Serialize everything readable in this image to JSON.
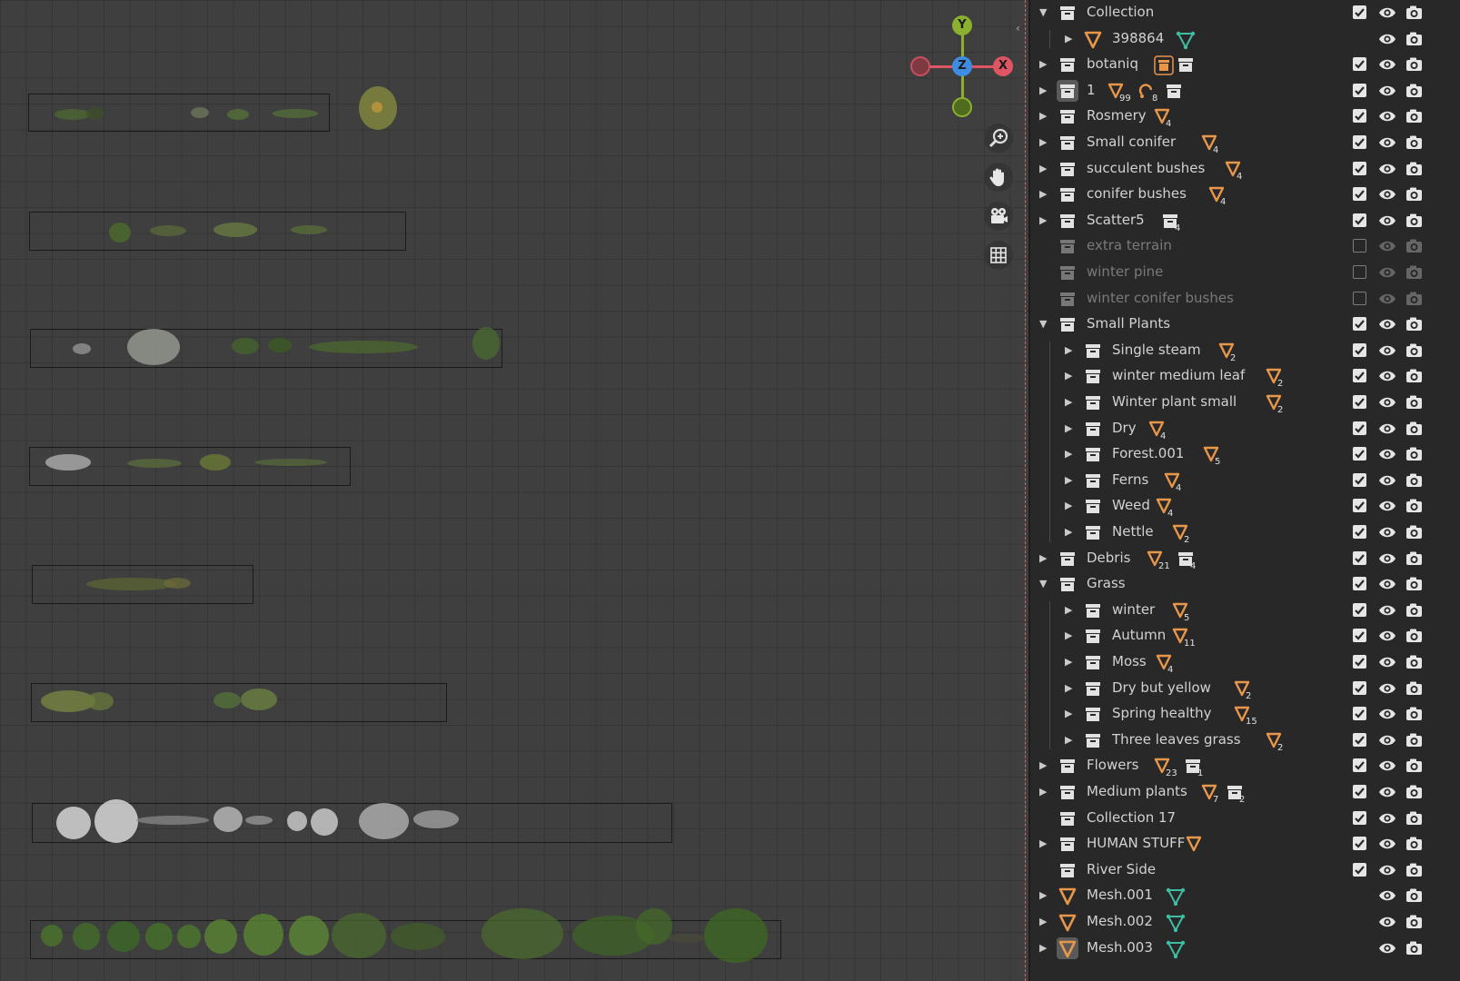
{
  "viewport": {
    "gizmo": {
      "y_label": "Y",
      "z_label": "Z",
      "x_label": "X"
    },
    "navigation": [
      {
        "name": "zoom-icon"
      },
      {
        "name": "pan-hand-icon"
      },
      {
        "name": "camera-view-icon"
      },
      {
        "name": "ortho-grid-icon"
      }
    ]
  },
  "outliner": {
    "rows": [
      {
        "label": "Collection",
        "depth": 0,
        "arrow": "down",
        "icon": "collection",
        "check": "on",
        "visible": true,
        "badges": []
      },
      {
        "label": "398864",
        "depth": 1,
        "arrow": "right",
        "icon": "mesh-object",
        "check": "none",
        "visible": true,
        "badges": [
          {
            "type": "mesh-data"
          }
        ]
      },
      {
        "label": "botaniq",
        "depth": 0,
        "arrow": "right",
        "icon": "collection",
        "check": "on",
        "visible": true,
        "badges": [
          {
            "type": "linked-collection"
          },
          {
            "type": "collection"
          }
        ]
      },
      {
        "label": "1",
        "depth": 0,
        "arrow": "right",
        "icon": "collection-selected",
        "check": "on",
        "visible": true,
        "badges": [
          {
            "type": "mesh",
            "count": "99"
          },
          {
            "type": "hook",
            "count": "8"
          },
          {
            "type": "collection"
          }
        ]
      },
      {
        "label": "Rosmery",
        "depth": 0,
        "arrow": "right",
        "icon": "collection",
        "check": "on",
        "visible": true,
        "badges": [
          {
            "type": "mesh",
            "count": "4"
          }
        ]
      },
      {
        "label": "Small conifer",
        "depth": 0,
        "arrow": "right",
        "icon": "collection",
        "check": "on",
        "visible": true,
        "badges": [
          {
            "type": "mesh",
            "count": "4"
          }
        ]
      },
      {
        "label": "succulent bushes",
        "depth": 0,
        "arrow": "right",
        "icon": "collection",
        "check": "on",
        "visible": true,
        "badges": [
          {
            "type": "mesh",
            "count": "4"
          }
        ]
      },
      {
        "label": "conifer bushes",
        "depth": 0,
        "arrow": "right",
        "icon": "collection",
        "check": "on",
        "visible": true,
        "badges": [
          {
            "type": "mesh",
            "count": "4"
          }
        ]
      },
      {
        "label": "Scatter5",
        "depth": 0,
        "arrow": "right",
        "icon": "collection",
        "check": "on",
        "visible": true,
        "badges": [
          {
            "type": "collection",
            "count": "4"
          }
        ]
      },
      {
        "label": "extra terrain",
        "depth": 0,
        "arrow": "none",
        "icon": "collection",
        "check": "off",
        "visible": false,
        "badges": []
      },
      {
        "label": "winter pine",
        "depth": 0,
        "arrow": "none",
        "icon": "collection",
        "check": "off",
        "visible": false,
        "badges": []
      },
      {
        "label": "winter conifer bushes",
        "depth": 0,
        "arrow": "none",
        "icon": "collection",
        "check": "off",
        "visible": false,
        "badges": []
      },
      {
        "label": "Small Plants",
        "depth": 0,
        "arrow": "down",
        "icon": "collection",
        "check": "on",
        "visible": true,
        "badges": []
      },
      {
        "label": "Single steam",
        "depth": 1,
        "arrow": "right",
        "icon": "collection",
        "check": "on",
        "visible": true,
        "badges": [
          {
            "type": "mesh",
            "count": "2"
          }
        ]
      },
      {
        "label": "winter medium leaf",
        "depth": 1,
        "arrow": "right",
        "icon": "collection",
        "check": "on",
        "visible": true,
        "badges": [
          {
            "type": "mesh",
            "count": "2"
          }
        ]
      },
      {
        "label": "Winter plant small",
        "depth": 1,
        "arrow": "right",
        "icon": "collection",
        "check": "on",
        "visible": true,
        "badges": [
          {
            "type": "mesh",
            "count": "2"
          }
        ]
      },
      {
        "label": "Dry",
        "depth": 1,
        "arrow": "right",
        "icon": "collection",
        "check": "on",
        "visible": true,
        "badges": [
          {
            "type": "mesh",
            "count": "4"
          }
        ]
      },
      {
        "label": "Forest.001",
        "depth": 1,
        "arrow": "right",
        "icon": "collection",
        "check": "on",
        "visible": true,
        "badges": [
          {
            "type": "mesh",
            "count": "5"
          }
        ]
      },
      {
        "label": "Ferns",
        "depth": 1,
        "arrow": "right",
        "icon": "collection",
        "check": "on",
        "visible": true,
        "badges": [
          {
            "type": "mesh",
            "count": "4"
          }
        ]
      },
      {
        "label": "Weed",
        "depth": 1,
        "arrow": "right",
        "icon": "collection",
        "check": "on",
        "visible": true,
        "badges": [
          {
            "type": "mesh",
            "count": "4"
          }
        ]
      },
      {
        "label": "Nettle",
        "depth": 1,
        "arrow": "right",
        "icon": "collection",
        "check": "on",
        "visible": true,
        "badges": [
          {
            "type": "mesh",
            "count": "2"
          }
        ]
      },
      {
        "label": "Debris",
        "depth": 0,
        "arrow": "right",
        "icon": "collection",
        "check": "on",
        "visible": true,
        "badges": [
          {
            "type": "mesh",
            "count": "21"
          },
          {
            "type": "collection",
            "count": "4"
          }
        ]
      },
      {
        "label": "Grass",
        "depth": 0,
        "arrow": "down",
        "icon": "collection",
        "check": "on",
        "visible": true,
        "badges": []
      },
      {
        "label": "winter",
        "depth": 1,
        "arrow": "right",
        "icon": "collection",
        "check": "on",
        "visible": true,
        "badges": [
          {
            "type": "mesh",
            "count": "5"
          }
        ]
      },
      {
        "label": "Autumn",
        "depth": 1,
        "arrow": "right",
        "icon": "collection",
        "check": "on",
        "visible": true,
        "badges": [
          {
            "type": "mesh",
            "count": "11"
          }
        ]
      },
      {
        "label": "Moss",
        "depth": 1,
        "arrow": "right",
        "icon": "collection",
        "check": "on",
        "visible": true,
        "badges": [
          {
            "type": "mesh",
            "count": "4"
          }
        ]
      },
      {
        "label": "Dry but yellow",
        "depth": 1,
        "arrow": "right",
        "icon": "collection",
        "check": "on",
        "visible": true,
        "badges": [
          {
            "type": "mesh",
            "count": "2"
          }
        ]
      },
      {
        "label": "Spring healthy",
        "depth": 1,
        "arrow": "right",
        "icon": "collection",
        "check": "on",
        "visible": true,
        "badges": [
          {
            "type": "mesh",
            "count": "15"
          }
        ]
      },
      {
        "label": "Three leaves grass",
        "depth": 1,
        "arrow": "right",
        "icon": "collection",
        "check": "on",
        "visible": true,
        "badges": [
          {
            "type": "mesh",
            "count": "2"
          }
        ]
      },
      {
        "label": "Flowers",
        "depth": 0,
        "arrow": "right",
        "icon": "collection",
        "check": "on",
        "visible": true,
        "badges": [
          {
            "type": "mesh",
            "count": "23"
          },
          {
            "type": "collection",
            "count": "1"
          }
        ]
      },
      {
        "label": "Medium plants",
        "depth": 0,
        "arrow": "right",
        "icon": "collection",
        "check": "on",
        "visible": true,
        "badges": [
          {
            "type": "mesh",
            "count": "7"
          },
          {
            "type": "collection",
            "count": "2"
          }
        ]
      },
      {
        "label": "Collection 17",
        "depth": 0,
        "arrow": "none",
        "icon": "collection",
        "check": "on",
        "visible": true,
        "badges": []
      },
      {
        "label": "HUMAN STUFF",
        "depth": 0,
        "arrow": "right",
        "icon": "collection",
        "check": "on",
        "visible": true,
        "badges": [
          {
            "type": "mesh"
          }
        ]
      },
      {
        "label": "River Side",
        "depth": 0,
        "arrow": "none",
        "icon": "collection",
        "check": "on",
        "visible": true,
        "badges": []
      },
      {
        "label": "Mesh.001",
        "depth": 0,
        "arrow": "right",
        "icon": "mesh-object",
        "check": "none",
        "visible": true,
        "badges": [
          {
            "type": "mesh-data"
          }
        ]
      },
      {
        "label": "Mesh.002",
        "depth": 0,
        "arrow": "right",
        "icon": "mesh-object",
        "check": "none",
        "visible": true,
        "badges": [
          {
            "type": "mesh-data"
          }
        ]
      },
      {
        "label": "Mesh.003",
        "depth": 0,
        "arrow": "right",
        "icon": "mesh-object-selected",
        "check": "none",
        "visible": true,
        "badges": [
          {
            "type": "mesh-data"
          }
        ]
      }
    ]
  },
  "colors": {
    "accent_orange": "#e8964a",
    "mesh_data_teal": "#3fbda2",
    "axis_x": "#e05563",
    "axis_y": "#8ab02e",
    "axis_z": "#3f8de3"
  }
}
